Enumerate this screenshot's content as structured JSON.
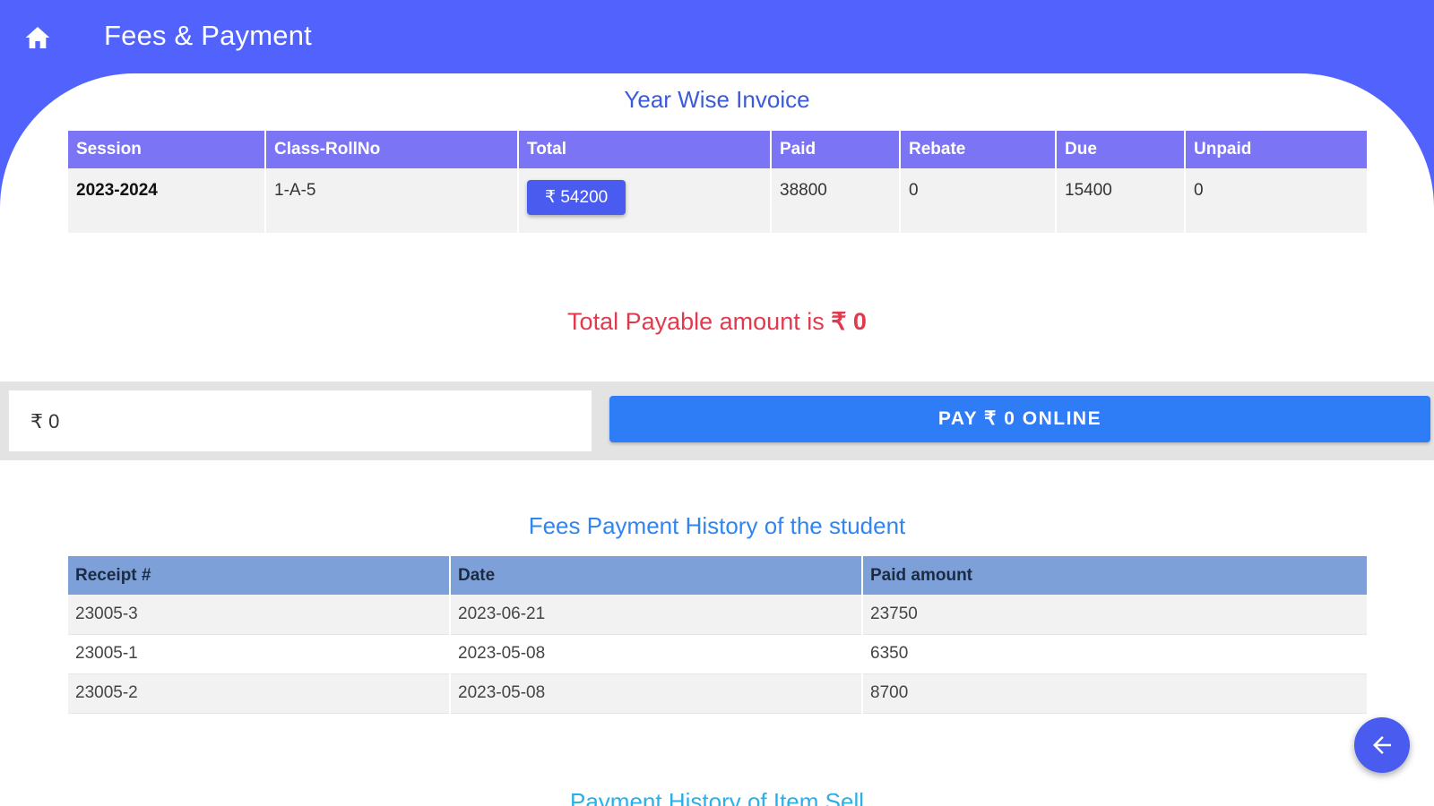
{
  "header": {
    "title": "Fees & Payment",
    "home_icon": "home-icon"
  },
  "invoice": {
    "title": "Year Wise Invoice",
    "columns": [
      "Session",
      "Class-RollNo",
      "Total",
      "Paid",
      "Rebate",
      "Due",
      "Unpaid"
    ],
    "row": {
      "session": "2023-2024",
      "class_roll": "1-A-5",
      "total": "₹ 54200",
      "paid": "38800",
      "rebate": "0",
      "due": "15400",
      "unpaid": "0"
    }
  },
  "payable": {
    "label": "Total Payable amount is",
    "amount": "₹ 0"
  },
  "pay": {
    "amount_value": "₹ 0",
    "button_label": "PAY ₹ 0 ONLINE"
  },
  "history": {
    "title": "Fees Payment History of the student",
    "columns": [
      "Receipt #",
      "Date",
      "Paid amount"
    ],
    "rows": [
      {
        "receipt": "23005-3",
        "date": "2023-06-21",
        "amount": "23750"
      },
      {
        "receipt": "23005-1",
        "date": "2023-05-08",
        "amount": "6350"
      },
      {
        "receipt": "23005-2",
        "date": "2023-05-08",
        "amount": "8700"
      }
    ]
  },
  "item_history": {
    "title": "Payment History of Item Sell"
  },
  "fab": {
    "icon": "arrow-left-icon"
  },
  "colors": {
    "primary": "#5262fc",
    "invoice_header": "#7b74f5",
    "history_header": "#7ea0d8",
    "pay_button": "#2e7cf6",
    "payable_text": "#e03a4e"
  }
}
